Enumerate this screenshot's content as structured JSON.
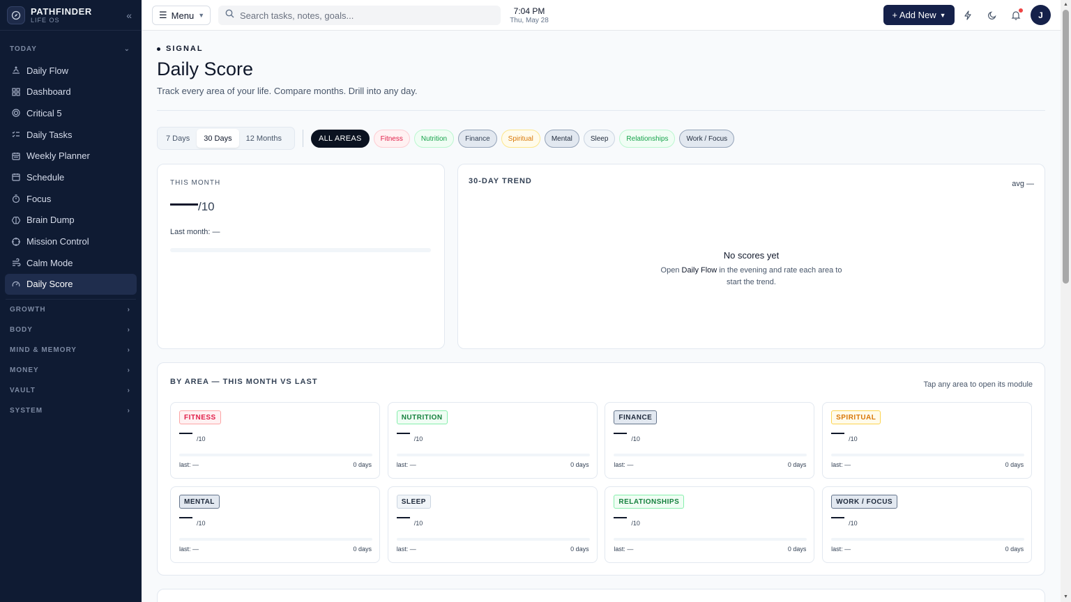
{
  "brand": {
    "name": "PATHFINDER",
    "sub": "LIFE OS"
  },
  "sidebar": {
    "today_label": "TODAY",
    "items": [
      {
        "label": "Daily Flow",
        "icon": "sunrise-icon"
      },
      {
        "label": "Dashboard",
        "icon": "grid-icon"
      },
      {
        "label": "Critical 5",
        "icon": "target-icon"
      },
      {
        "label": "Daily Tasks",
        "icon": "list-check-icon"
      },
      {
        "label": "Weekly Planner",
        "icon": "calendar-week-icon"
      },
      {
        "label": "Schedule",
        "icon": "calendar-icon"
      },
      {
        "label": "Focus",
        "icon": "timer-icon"
      },
      {
        "label": "Brain Dump",
        "icon": "brain-icon"
      },
      {
        "label": "Mission Control",
        "icon": "crosshair-icon"
      },
      {
        "label": "Calm Mode",
        "icon": "wind-icon"
      },
      {
        "label": "Daily Score",
        "icon": "gauge-icon",
        "active": true
      }
    ],
    "sections": [
      "GROWTH",
      "BODY",
      "MIND & MEMORY",
      "MONEY",
      "VAULT",
      "SYSTEM"
    ]
  },
  "header": {
    "menu_label": "Menu",
    "search_placeholder": "Search tasks, notes, goals...",
    "time": "7:04 PM",
    "date": "Thu, May 28",
    "add_label": "+ Add New",
    "avatar_initial": "J",
    "accent": "#15214a",
    "notification_dot_color": "#ef4444"
  },
  "page": {
    "eyebrow": "SIGNAL",
    "title": "Daily Score",
    "subtitle": "Track every area of your life. Compare months. Drill into any day."
  },
  "ranges": {
    "items": [
      "7 Days",
      "30 Days",
      "12 Months"
    ],
    "selected": "30 Days"
  },
  "areas_filter": {
    "all_label": "ALL AREAS",
    "chips": [
      {
        "label": "Fitness",
        "color": "#e11d48",
        "bg": "#fff1f2",
        "border": "#fecdd3"
      },
      {
        "label": "Nutrition",
        "color": "#16a34a",
        "bg": "#f0fdf4",
        "border": "#bbf7d0"
      },
      {
        "label": "Finance",
        "color": "#334155",
        "bg": "#e2e8f0",
        "border": "#94a3b8"
      },
      {
        "label": "Spiritual",
        "color": "#d97706",
        "bg": "#fffbeb",
        "border": "#fde68a"
      },
      {
        "label": "Mental",
        "color": "#1e293b",
        "bg": "#e2e8f0",
        "border": "#94a3b8"
      },
      {
        "label": "Sleep",
        "color": "#1e293b",
        "bg": "#f1f5f9",
        "border": "#cbd5e1"
      },
      {
        "label": "Relationships",
        "color": "#16a34a",
        "bg": "#f0fdf4",
        "border": "#bbf7d0"
      },
      {
        "label": "Work / Focus",
        "color": "#1e293b",
        "bg": "#e2e8f0",
        "border": "#94a3b8"
      }
    ]
  },
  "month_card": {
    "label": "THIS MONTH",
    "score_suffix": "/10",
    "last_month": "Last month: —"
  },
  "trend_card": {
    "title": "30-DAY TREND",
    "avg": "avg —",
    "empty_title": "No scores yet",
    "empty_pre": "Open",
    "empty_link": "Daily Flow",
    "empty_post_1": "in the evening and rate each area to",
    "empty_post_2": "start the trend."
  },
  "by_area": {
    "title": "BY AREA — THIS MONTH VS LAST",
    "hint": "Tap any area to open its module",
    "cards": [
      {
        "label": "FITNESS",
        "suffix": "/10",
        "last": "last: —",
        "days": "0 days",
        "color": "#e11d48",
        "bg": "#fff1f2",
        "border": "#fca5a5"
      },
      {
        "label": "NUTRITION",
        "suffix": "/10",
        "last": "last: —",
        "days": "0 days",
        "color": "#15803d",
        "bg": "#f0fdf4",
        "border": "#86efac"
      },
      {
        "label": "FINANCE",
        "suffix": "/10",
        "last": "last: —",
        "days": "0 days",
        "color": "#1e293b",
        "bg": "#e2e8f0",
        "border": "#64748b"
      },
      {
        "label": "SPIRITUAL",
        "suffix": "/10",
        "last": "last: —",
        "days": "0 days",
        "color": "#d97706",
        "bg": "#fffbeb",
        "border": "#fcd34d"
      },
      {
        "label": "MENTAL",
        "suffix": "/10",
        "last": "last: —",
        "days": "0 days",
        "color": "#1e293b",
        "bg": "#e2e8f0",
        "border": "#64748b"
      },
      {
        "label": "SLEEP",
        "suffix": "/10",
        "last": "last: —",
        "days": "0 days",
        "color": "#1e293b",
        "bg": "#f1f5f9",
        "border": "#cbd5e1"
      },
      {
        "label": "RELATIONSHIPS",
        "suffix": "/10",
        "last": "last: —",
        "days": "0 days",
        "color": "#15803d",
        "bg": "#f0fdf4",
        "border": "#86efac"
      },
      {
        "label": "WORK / FOCUS",
        "suffix": "/10",
        "last": "last: —",
        "days": "0 days",
        "color": "#1e293b",
        "bg": "#e2e8f0",
        "border": "#64748b"
      }
    ]
  }
}
